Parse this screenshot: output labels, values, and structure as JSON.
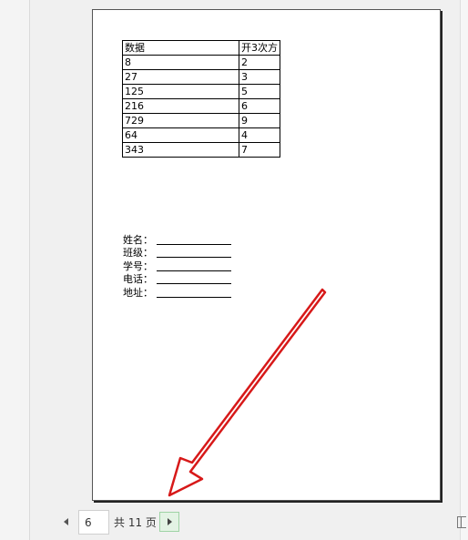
{
  "document": {
    "table": {
      "headers": [
        "数据",
        "开3次方"
      ],
      "rows": [
        [
          "8",
          "2"
        ],
        [
          "27",
          "3"
        ],
        [
          "125",
          "5"
        ],
        [
          "216",
          "6"
        ],
        [
          "729",
          "9"
        ],
        [
          "64",
          "4"
        ],
        [
          "343",
          "7"
        ]
      ]
    },
    "form_fields": [
      {
        "label": "姓名："
      },
      {
        "label": "班级："
      },
      {
        "label": "学号："
      },
      {
        "label": "电话："
      },
      {
        "label": "地址："
      }
    ]
  },
  "annotation": {
    "arrow_icon": "red-arrow-icon",
    "arrow_color": "#d71919"
  },
  "pagination": {
    "current_page": "6",
    "total_label": "共 11 页",
    "prev_icon": "caret-left-icon",
    "next_icon": "caret-right-icon",
    "accent": "#e3f3e4"
  },
  "toolbar": {
    "view_icon": "page-view-icon"
  }
}
